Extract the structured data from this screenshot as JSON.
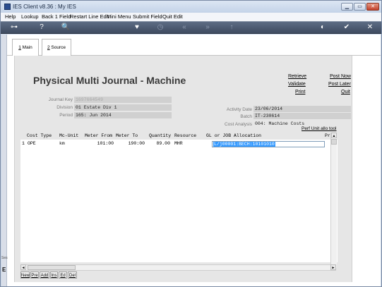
{
  "window": {
    "title": "IES Client v8.36 : My IES"
  },
  "window_controls": {
    "minimize": "▁",
    "maximize": "▭",
    "close": "✕"
  },
  "menu": [
    "Help",
    "Lookup",
    "Back 1 Field",
    "Restart Line Edit",
    "Mini Menu",
    "Submit Field",
    "Quit Edit"
  ],
  "toolbar": {
    "icons": [
      "key-icon",
      "help-icon",
      "search-icon",
      "heart-icon",
      "clock-icon",
      "rewind-icon",
      "fast-forward-icon",
      "upload-icon",
      "save-icon",
      "confirm-icon",
      "close-icon"
    ],
    "glyphs": [
      "⊶",
      "?",
      "🔍",
      "♥",
      "◷",
      "«",
      "»",
      "↑",
      "◐",
      "✔",
      "✕"
    ]
  },
  "tabs": [
    {
      "hot": "1",
      "rest": " Main"
    },
    {
      "hot": "2",
      "rest": " Source"
    }
  ],
  "sidebar": {
    "label": "Ses",
    "mark": "E"
  },
  "form": {
    "title": "Physical Multi Journal - Machine",
    "actions": {
      "retrieve": "Retrieve",
      "validate": "Validate",
      "print": "Print",
      "post_now": "Post Now",
      "post_later": "Post Later",
      "quit": "Quit"
    },
    "journal_key_label": "Journal Key",
    "journal_key_value": "1697664549",
    "division_label": "Division",
    "division_value": "01 Estate Div 1",
    "period_label": "Period",
    "period_value": "165: Jun 2014",
    "activity_date_label": "Activity Date",
    "activity_date_value": "23/06/2014",
    "batch_label": "Batch",
    "batch_value": "IT-230614",
    "cost_analysis_label": "Cost Analysis",
    "cost_analysis_value": "004: Machine Costs",
    "perf_link": "Perf Unit allo tool"
  },
  "grid": {
    "headers": [
      "Cost Type",
      "Mc-Unit",
      "Meter From",
      "Meter To",
      "Quantity",
      "Resource",
      "GL or JOB Allocation",
      "Pr"
    ],
    "rows": [
      {
        "line": "1",
        "cost_type": "OPE",
        "mc_unit": "km",
        "meter_from": "101:00",
        "meter_to": "190:00",
        "quantity": "89.00",
        "resource": "MHR",
        "allocation": "L/j00001:BECH:10101010"
      }
    ]
  },
  "scroll": {
    "up": "▲",
    "down": "▼",
    "left": "◄",
    "right": "►"
  },
  "bottom_tabs": [
    "New",
    "Pre",
    "Add",
    "Ins",
    "Ed",
    "Del"
  ]
}
